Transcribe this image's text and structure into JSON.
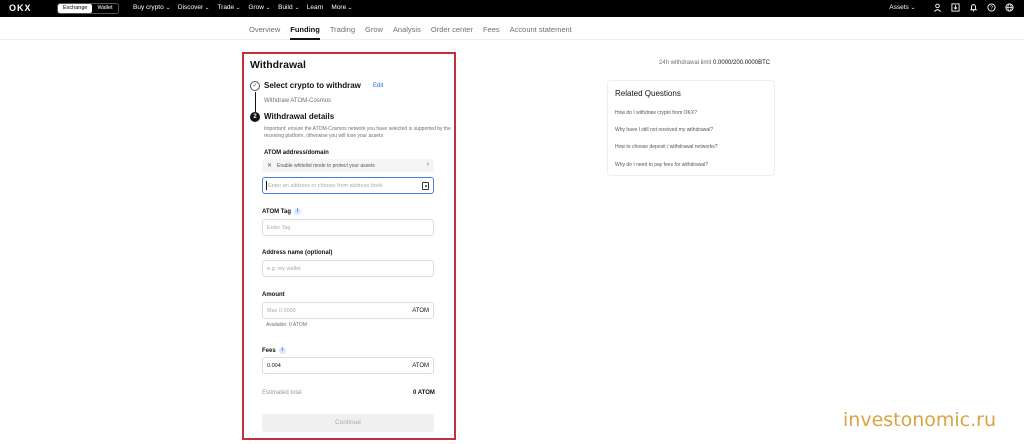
{
  "topbar": {
    "logo": "OKX",
    "mode_tabs": [
      "Exchange",
      "Wallet"
    ],
    "nav": [
      "Buy crypto",
      "Discover",
      "Trade",
      "Grow",
      "Build",
      "Learn",
      "More"
    ],
    "assets_label": "Assets",
    "icons": [
      "user-icon",
      "download-icon",
      "bell-icon",
      "help-icon",
      "globe-icon"
    ]
  },
  "subnav": {
    "tabs": [
      "Overview",
      "Funding",
      "Trading",
      "Grow",
      "Analysis",
      "Order center",
      "Fees",
      "Account statement"
    ],
    "active": "Funding"
  },
  "withdrawal": {
    "title": "Withdrawal",
    "step1_title": "Select crypto to withdraw",
    "step1_edit": "Edit",
    "step1_sub": "Withdraw ATOM-Cosmos",
    "step2_num": "2",
    "step2_title": "Withdrawal details",
    "notice": "Important: ensure the ATOM-Cosmos network you have selected is supported by the receiving platform, otherwise you will lose your assets",
    "address_label": "ATOM address/domain",
    "whitelist_text": "Enable whitelist mode to protect your assets",
    "address_placeholder": "Enter an address or choose from address book",
    "tag_label": "ATOM Tag",
    "tag_placeholder": "Enter Tag",
    "name_label": "Address name (optional)",
    "name_placeholder": "e.g. my wallet",
    "amount_label": "Amount",
    "amount_placeholder": "Max 0.0000",
    "amount_unit": "ATOM",
    "available": "Available: 0 ATOM",
    "fees_label": "Fees",
    "fees_value": "0.004",
    "fees_unit": "ATOM",
    "est_label": "Estimated total",
    "est_value": "0 ATOM",
    "continue_label": "Continue"
  },
  "limit": {
    "label": "24h withdrawal limit",
    "value": "0.0000/200.0000BTC"
  },
  "related": {
    "title": "Related Questions",
    "items": [
      "How do I withdraw crypto from OKX?",
      "Why have I still not received my withdrawal?",
      "How to choose deposit / withdrawal networks?",
      "Why do I need to pay fees for withdrawal?"
    ]
  },
  "watermark": "investonomic.ru",
  "colors": {
    "highlight": "#c4303a",
    "link": "#2a6ae8"
  }
}
